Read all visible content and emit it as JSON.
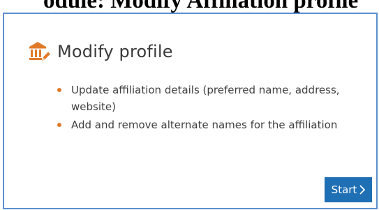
{
  "clipped_heading": "odule: Modify Affiliation profile",
  "card": {
    "title": "Modify profile",
    "icon": "institution-edit-icon",
    "accent_color": "#e07b2a",
    "bullets": [
      "Update affiliation details (preferred name, address, website)",
      "Add and remove alternate names for the affiliation"
    ],
    "start_button": {
      "label": "Start",
      "icon": "chevron-right-icon",
      "color": "#1f6fb5"
    }
  }
}
